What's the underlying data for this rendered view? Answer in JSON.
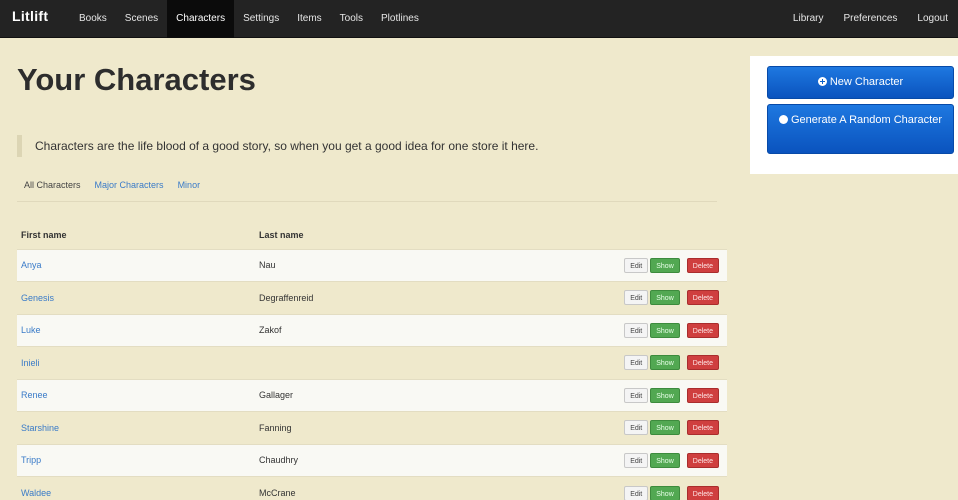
{
  "navbar": {
    "brand": "Litlift",
    "left_items": [
      "Books",
      "Scenes",
      "Characters",
      "Settings",
      "Items",
      "Tools",
      "Plotlines"
    ],
    "active_item": "Characters",
    "right_items": [
      "Library",
      "Preferences",
      "Logout"
    ]
  },
  "page": {
    "title": "Your Characters",
    "lead": "Characters are the life blood of a good story, so when you get a good idea for one store it here."
  },
  "tabs": [
    "All Characters",
    "Major Characters",
    "Minor"
  ],
  "active_tab": "All Characters",
  "table": {
    "headers": [
      "First name",
      "Last name"
    ],
    "rows": [
      {
        "first": "Anya",
        "last": "Nau"
      },
      {
        "first": "Genesis",
        "last": "Degraffenreid"
      },
      {
        "first": "Luke",
        "last": "Zakof"
      },
      {
        "first": "Inieli",
        "last": ""
      },
      {
        "first": "Renee",
        "last": "Gallager"
      },
      {
        "first": "Starshine",
        "last": "Fanning"
      },
      {
        "first": "Tripp",
        "last": "Chaudhry"
      },
      {
        "first": "Waldee",
        "last": "McCrane"
      }
    ],
    "actions": {
      "edit": "Edit",
      "show": "Show",
      "delete": "Delete"
    }
  },
  "sidebar": {
    "new_character": "New Character",
    "random_character": "Generate A Random Character"
  },
  "colors": {
    "background": "#efe9cc",
    "navbar": "#232323",
    "primary": "#0a53be",
    "success": "#52a852",
    "danger": "#cf3f3f",
    "link": "#3a7bc8"
  }
}
